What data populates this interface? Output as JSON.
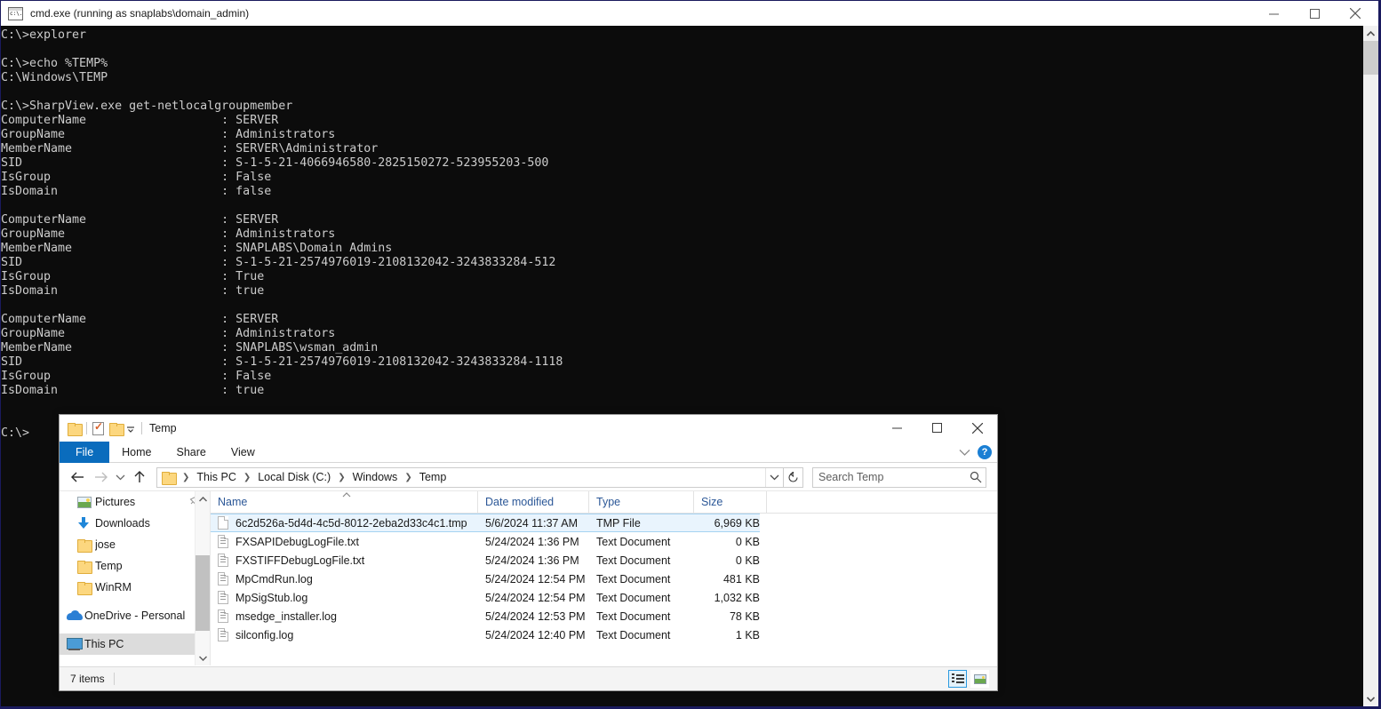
{
  "cmd": {
    "title": "cmd.exe (running as snaplabs\\domain_admin)",
    "icon": "console-icon",
    "controls": {
      "minimize": "minimize-icon",
      "maximize": "maximize-icon",
      "close": "close-icon"
    },
    "console_text": "C:\\>explorer\n\nC:\\>echo %TEMP%\nC:\\Windows\\TEMP\n\nC:\\>SharpView.exe get-netlocalgroupmember\nComputerName                   : SERVER\nGroupName                      : Administrators\nMemberName                     : SERVER\\Administrator\nSID                            : S-1-5-21-4066946580-2825150272-523955203-500\nIsGroup                        : False\nIsDomain                       : false\n\nComputerName                   : SERVER\nGroupName                      : Administrators\nMemberName                     : SNAPLABS\\Domain Admins\nSID                            : S-1-5-21-2574976019-2108132042-3243833284-512\nIsGroup                        : True\nIsDomain                       : true\n\nComputerName                   : SERVER\nGroupName                      : Administrators\nMemberName                     : SNAPLABS\\wsman_admin\nSID                            : S-1-5-21-2574976019-2108132042-3243833284-1118\nIsGroup                        : False\nIsDomain                       : true\n\n\nC:\\>",
    "colors": {
      "background": "#0c0c0c",
      "foreground": "#cccccc",
      "border": "#1a1a5e",
      "titlebar": "#ffffff"
    }
  },
  "explorer": {
    "title": "Temp",
    "quick_access": [
      "folder-icon",
      "properties-icon",
      "new-folder-icon",
      "customize-caret-icon"
    ],
    "controls": {
      "minimize": "minimize-icon",
      "maximize": "maximize-icon",
      "close": "close-icon"
    },
    "ribbon": {
      "tabs": [
        {
          "label": "File",
          "active": true
        },
        {
          "label": "Home",
          "active": false
        },
        {
          "label": "Share",
          "active": false
        },
        {
          "label": "View",
          "active": false
        }
      ],
      "collapse_icon": "chevron-down-icon",
      "help_label": "?",
      "accent": "#0a6cbd"
    },
    "address": {
      "back": "arrow-left-icon",
      "forward": "arrow-right-icon",
      "recent": "chevron-down-icon",
      "up": "arrow-up-icon",
      "folder_icon": "folder-icon",
      "breadcrumbs": [
        "This PC",
        "Local Disk (C:)",
        "Windows",
        "Temp"
      ],
      "dropdown": "chevron-down-icon",
      "refresh": "refresh-icon"
    },
    "search": {
      "placeholder": "Search Temp",
      "icon": "search-icon"
    },
    "nav_pane": {
      "items": [
        {
          "label": "Pictures",
          "icon": "pictures-icon",
          "indent": true,
          "pinned": true,
          "selected": false
        },
        {
          "label": "Downloads",
          "icon": "downloads-icon",
          "indent": true,
          "pinned": false,
          "selected": false
        },
        {
          "label": "jose",
          "icon": "folder-icon",
          "indent": true,
          "pinned": false,
          "selected": false
        },
        {
          "label": "Temp",
          "icon": "folder-icon",
          "indent": true,
          "pinned": false,
          "selected": false
        },
        {
          "label": "WinRM",
          "icon": "folder-icon",
          "indent": true,
          "pinned": false,
          "selected": false
        },
        {
          "label": "OneDrive - Personal",
          "icon": "onedrive-icon",
          "indent": false,
          "pinned": false,
          "selected": false
        },
        {
          "label": "This PC",
          "icon": "this-pc-icon",
          "indent": false,
          "pinned": false,
          "selected": true
        }
      ],
      "scroll_up": "chevron-up-icon",
      "scroll_down": "chevron-down-icon"
    },
    "file_list": {
      "columns": [
        "Name",
        "Date modified",
        "Type",
        "Size"
      ],
      "sort_column": "Name",
      "sort_direction": "ascending",
      "rows": [
        {
          "name": "6c2d526a-5d4d-4c5d-8012-2eba2d33c4c1.tmp",
          "date": "5/6/2024 11:37 AM",
          "type": "TMP File",
          "size": "6,969 KB",
          "icon": "blank-document-icon",
          "selected": true
        },
        {
          "name": "FXSAPIDebugLogFile.txt",
          "date": "5/24/2024 1:36 PM",
          "type": "Text Document",
          "size": "0 KB",
          "icon": "text-document-icon",
          "selected": false
        },
        {
          "name": "FXSTIFFDebugLogFile.txt",
          "date": "5/24/2024 1:36 PM",
          "type": "Text Document",
          "size": "0 KB",
          "icon": "text-document-icon",
          "selected": false
        },
        {
          "name": "MpCmdRun.log",
          "date": "5/24/2024 12:54 PM",
          "type": "Text Document",
          "size": "481 KB",
          "icon": "text-document-icon",
          "selected": false
        },
        {
          "name": "MpSigStub.log",
          "date": "5/24/2024 12:54 PM",
          "type": "Text Document",
          "size": "1,032 KB",
          "icon": "text-document-icon",
          "selected": false
        },
        {
          "name": "msedge_installer.log",
          "date": "5/24/2024 12:53 PM",
          "type": "Text Document",
          "size": "78 KB",
          "icon": "text-document-icon",
          "selected": false
        },
        {
          "name": "silconfig.log",
          "date": "5/24/2024 12:40 PM",
          "type": "Text Document",
          "size": "1 KB",
          "icon": "text-document-icon",
          "selected": false
        }
      ]
    },
    "status": {
      "item_count": "7 items",
      "views": [
        {
          "name": "details-view-icon",
          "active": true
        },
        {
          "name": "large-icons-view-icon",
          "active": false
        }
      ]
    }
  }
}
